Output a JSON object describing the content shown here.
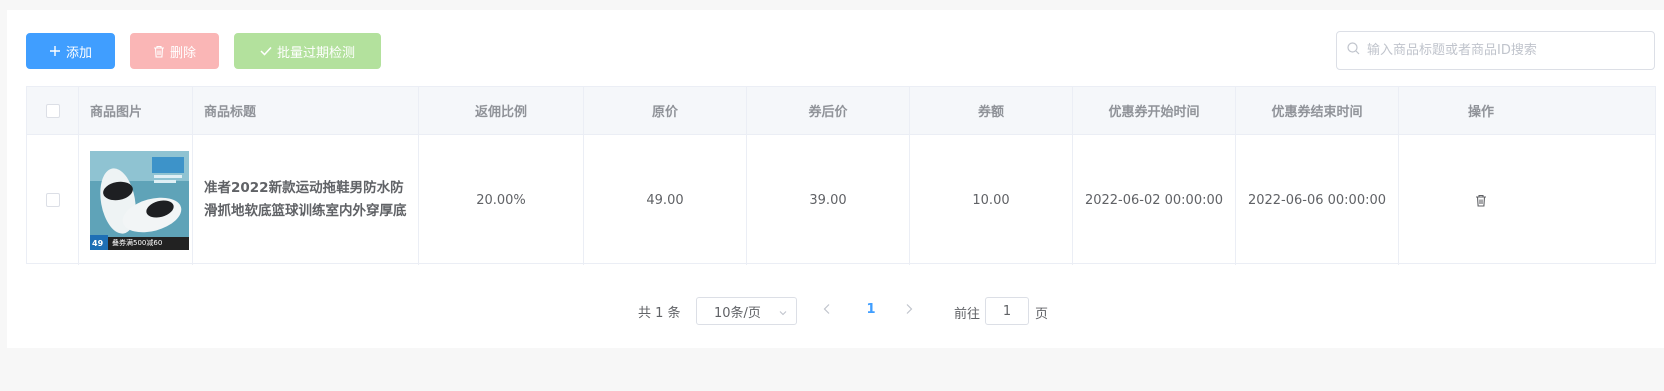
{
  "toolbar": {
    "add_label": "添加",
    "delete_label": "删除",
    "batch_check_label": "批量过期检测",
    "add_color": "#409eff",
    "delete_color": "#fab6b6",
    "batch_check_color": "#b3e19d"
  },
  "search": {
    "placeholder": "输入商品标题或者商品ID搜索",
    "value": ""
  },
  "table": {
    "columns": [
      "商品图片",
      "商品标题",
      "返佣比例",
      "原价",
      "券后价",
      "券额",
      "优惠券开始时间",
      "优惠券结束时间",
      "操作"
    ],
    "rows": [
      {
        "checked": false,
        "title": "准者2022新款运动拖鞋男防水防滑抓地软底篮球训练室内外穿厚底",
        "commission_rate": "20.00%",
        "original_price": "49.00",
        "coupon_price": "39.00",
        "coupon_amount": "10.00",
        "coupon_start": "2022-06-02 00:00:00",
        "coupon_end": "2022-06-06 00:00:00",
        "action_icon": "trash-icon"
      }
    ]
  },
  "thumbnail": {
    "price_tag": "49",
    "banner": "叠券满500减60"
  },
  "pagination": {
    "total": "共 1 条",
    "page_size": "10条/页",
    "current_page": "1",
    "goto_label": "前往",
    "goto_value": "1",
    "page_suffix": "页"
  }
}
